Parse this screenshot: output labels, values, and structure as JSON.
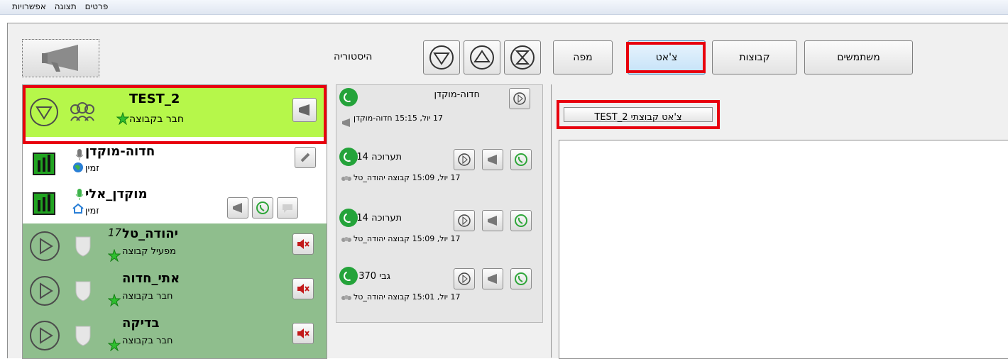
{
  "menu": [
    "פרטים",
    "תצוגה",
    "אפשרויות"
  ],
  "toolbar": {
    "history_label": "היסטוריה",
    "tabs": {
      "map": "מפה",
      "chat": "צ'אט",
      "groups": "קבוצות",
      "users": "משתמשים"
    }
  },
  "list": {
    "group": {
      "name": "TEST_2",
      "sub": "חבר בקבוצה"
    },
    "users": [
      {
        "name": "חדוה-מוקדן",
        "sub": "זמין"
      },
      {
        "name": "מוקדן_אלי",
        "sub": "זמין"
      }
    ],
    "members": [
      {
        "name": "יהודה_טל",
        "badge": "17",
        "sub": "מפעיל קבוצה"
      },
      {
        "name": "אתי_חדוה",
        "badge": "",
        "sub": "חבר בקבוצה"
      },
      {
        "name": "בדיקה",
        "badge": "",
        "sub": "חבר בקבוצה"
      }
    ]
  },
  "history": [
    {
      "name": "חדוה-מוקדן",
      "detail": "17 יול, 15:15 חדוה-מוקדן"
    },
    {
      "name": "תערוכה 14",
      "detail": "17 יול, 15:09 קבוצה יהודה_טל"
    },
    {
      "name": "תערוכה 14",
      "detail": "17 יול, 15:09 קבוצה יהודה_טל"
    },
    {
      "name": "גבי 370",
      "detail": "17 יול, 15:01 קבוצה יהודה_טל"
    }
  ],
  "chat": {
    "tab_label": "צ'אט קבוצתי TEST_2"
  },
  "colors": {
    "highlight_red": "#e8000e",
    "group_green": "#b6f74a",
    "member_green": "#8fbe8d",
    "call_green": "#24a33a"
  },
  "icons": [
    "megaphone-icon",
    "arrow-down-circle-icon",
    "arrow-up-circle-icon",
    "hourglass-icon",
    "group-icon",
    "star-icon",
    "signal-bars-icon",
    "microphone-icon",
    "globe-icon",
    "home-icon",
    "link-icon",
    "phone-icon",
    "play-icon",
    "shield-icon",
    "speaker-muted-icon",
    "call-icon"
  ]
}
